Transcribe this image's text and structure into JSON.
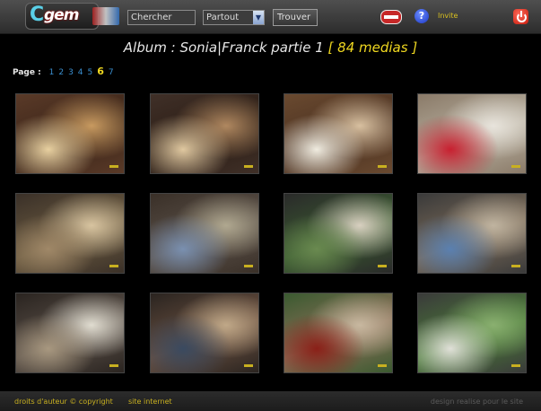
{
  "header": {
    "logo_text": "gem",
    "search_placeholder": "Chercher",
    "scope_value": "Partout",
    "find_label": "Trouver",
    "user_label": "Invite",
    "icons": [
      "flag-icon",
      "help-icon",
      "power-icon"
    ]
  },
  "album": {
    "prefix": "Album : ",
    "name": "Sonia|Franck partie 1",
    "count_text": "[ 84 medias ]"
  },
  "pager": {
    "label": "Page :",
    "pages": [
      "1",
      "2",
      "3",
      "4",
      "5",
      "6",
      "7"
    ],
    "current": "6"
  },
  "thumbnails": [
    {
      "desc": "church interior crowd",
      "colors": [
        "#3a2418",
        "#c89a60",
        "#e8d0a0",
        "#5a3a28"
      ]
    },
    {
      "desc": "church aisle guests",
      "colors": [
        "#2a1c14",
        "#b08860",
        "#e0c8a0",
        "#403028"
      ]
    },
    {
      "desc": "couple at altar",
      "colors": [
        "#4a3020",
        "#d8c0a0",
        "#f0ece0",
        "#6a4a30"
      ]
    },
    {
      "desc": "bride outside church",
      "colors": [
        "#b8b0a0",
        "#e8e4dc",
        "#c82030",
        "#8a7a68"
      ]
    },
    {
      "desc": "guests greeting",
      "colors": [
        "#6a5a40",
        "#d8c4a0",
        "#a08868",
        "#3a3028"
      ]
    },
    {
      "desc": "crowd at church door",
      "colors": [
        "#5a5048",
        "#b0a890",
        "#7a90b0",
        "#3a3028"
      ]
    },
    {
      "desc": "guests on street",
      "colors": [
        "#3a5a30",
        "#d8d0c0",
        "#6a8a50",
        "#2a2a2a"
      ]
    },
    {
      "desc": "crowd photographers",
      "colors": [
        "#7a6a58",
        "#c0b4a0",
        "#5a80b0",
        "#3a3a3a"
      ]
    },
    {
      "desc": "couple in car",
      "colors": [
        "#5a5048",
        "#e0dcd0",
        "#a89880",
        "#2a2420"
      ]
    },
    {
      "desc": "guests by church",
      "colors": [
        "#6a5040",
        "#c0a888",
        "#3a4a60",
        "#2a2420"
      ]
    },
    {
      "desc": "vintage red car",
      "colors": [
        "#8a7058",
        "#c8b8a0",
        "#8a2018",
        "#3a5a30"
      ]
    },
    {
      "desc": "group photo on lawn",
      "colors": [
        "#4a7a38",
        "#8ab070",
        "#e0e0d8",
        "#3a3a3a"
      ]
    }
  ],
  "footer": {
    "copyright_link": "droits d'auteur © copyright",
    "site_link": "site internet",
    "credit": "design realise pour le site"
  }
}
